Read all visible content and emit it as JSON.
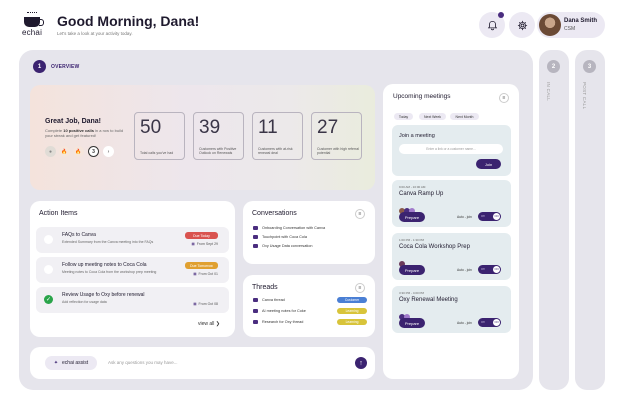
{
  "header": {
    "logo_text": "echai",
    "greeting": "Good Morning, Dana!",
    "subgreeting": "Let's take a look at your activity today.",
    "user_name": "Dana Smith",
    "user_role": "CSM"
  },
  "overview": {
    "step": "1",
    "label": "OVERVIEW",
    "hero_title": "Great Job, Dana!",
    "hero_sub_pre": "Complete ",
    "hero_sub_bold": "10 positive calls",
    "hero_sub_post": " in a row to build your streak and get featured!",
    "badge_step": "3",
    "badge_next": "›",
    "stats": [
      {
        "value": "50",
        "label": "Total calls you've had"
      },
      {
        "value": "39",
        "label": "Customers with Positive Outlook on Renewals"
      },
      {
        "value": "11",
        "label": "Customers with at-risk renewal deal"
      },
      {
        "value": "27",
        "label": "Customer with high referral potential"
      }
    ]
  },
  "action_items": {
    "title": "Action Items",
    "items": [
      {
        "title": "FAQs to Canva",
        "desc": "Extended Summary from the Canva meeting into the FAQs",
        "badge": "Due Today",
        "badge_color": "#d9534f",
        "from": "From Sept 29"
      },
      {
        "title": "Follow up meeting notes to Coca Cola",
        "desc": "Meeting notes to Coca Cola from the workshop prep meeting",
        "badge": "Due Tomorrow",
        "badge_color": "#e0a030",
        "from": "From Oct 01"
      },
      {
        "title": "Review Usage fo Oxy before renewal",
        "desc": "Add reflection for usage data",
        "badge": "",
        "badge_color": "",
        "from": "From Oct 08"
      }
    ],
    "view_all": "view all"
  },
  "conversations": {
    "title": "Conversations",
    "items": [
      "Onboarding Conversation with Canva",
      "Touchpoint with Coca Cola",
      "Oxy Usage Data conversation"
    ]
  },
  "threads": {
    "title": "Threads",
    "items": [
      {
        "label": "Canva thread",
        "badge": "Customer",
        "color": "#4a7fd4"
      },
      {
        "label": "AI meeting notes for Coke",
        "badge": "Learning",
        "color": "#d8c43a"
      },
      {
        "label": "Research for Oxy thread",
        "badge": "Learning",
        "color": "#d8c43a"
      }
    ]
  },
  "assist": {
    "button": "echai assist",
    "placeholder": "Ask any questions you may have..."
  },
  "meetings": {
    "title": "Upcoming meetings",
    "tabs": [
      "Today",
      "Next Week",
      "Next Month"
    ],
    "join_title": "Join a meeting",
    "join_placeholder": "Enter a link or a customer name...",
    "join_button": "Join",
    "items": [
      {
        "time": "9:00 AM - 10:00 AM",
        "name": "Canva Ramp Up",
        "extra": "+2",
        "prepare": "Prepare",
        "auto_join": "Auto - join",
        "off": "Off",
        "on": "ON"
      },
      {
        "time": "1:00 PM - 1:30 PM",
        "name": "Coca Cola Workshop Prep",
        "extra": "",
        "prepare": "Prepare",
        "auto_join": "Auto - join",
        "off": "Off",
        "on": "ON"
      },
      {
        "time": "3:30 PM - 4:00 PM",
        "name": "Oxy Renewal Meeting",
        "extra": "",
        "prepare": "Prepare",
        "auto_join": "Auto - join",
        "off": "Off",
        "on": "ON"
      }
    ]
  },
  "side": {
    "in_call_step": "2",
    "in_call_label": "IN CALL",
    "post_call_step": "3",
    "post_call_label": "POST CALL"
  }
}
